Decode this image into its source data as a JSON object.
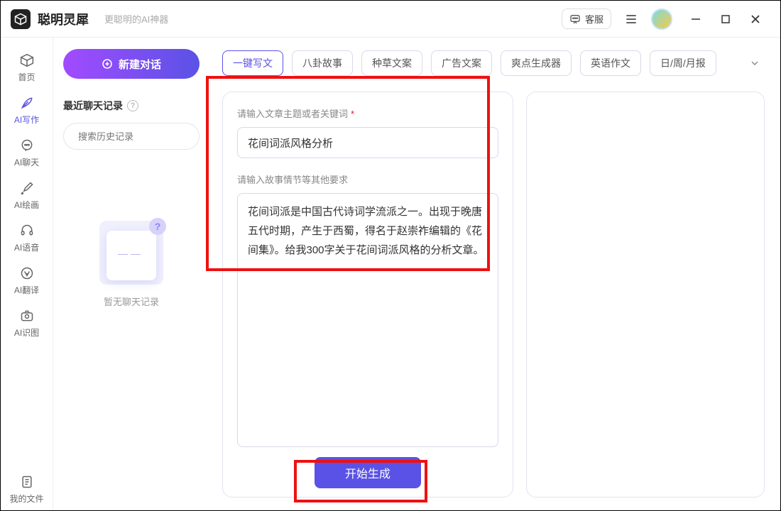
{
  "titlebar": {
    "app_name": "聪明灵犀",
    "tagline": "更聪明的AI神器",
    "cs_label": "客服"
  },
  "nav": {
    "items": [
      {
        "label": "首页",
        "icon": "home"
      },
      {
        "label": "AI写作",
        "icon": "feather"
      },
      {
        "label": "AI聊天",
        "icon": "chat"
      },
      {
        "label": "AI绘画",
        "icon": "brush"
      },
      {
        "label": "AI语音",
        "icon": "headset"
      },
      {
        "label": "AI翻译",
        "icon": "translate"
      },
      {
        "label": "AI识图",
        "icon": "camera"
      }
    ],
    "bottom": {
      "label": "我的文件",
      "icon": "file"
    }
  },
  "history": {
    "new_chat": "新建对话",
    "title": "最近聊天记录",
    "search_placeholder": "搜索历史记录",
    "empty": "暂无聊天记录"
  },
  "tabs": [
    "一键写文",
    "八卦故事",
    "种草文案",
    "广告文案",
    "爽点生成器",
    "英语作文",
    "日/周/月报"
  ],
  "form": {
    "topic_label": "请输入文章主题或者关键词",
    "topic_value": "花间词派风格分析",
    "detail_label": "请输入故事情节等其他要求",
    "detail_value": "花间词派是中国古代诗词学流派之一。出现于晚唐五代时期，产生于西蜀，得名于赵崇祚编辑的《花间集》。给我300字关于花间词派风格的分析文章。",
    "generate": "开始生成"
  }
}
